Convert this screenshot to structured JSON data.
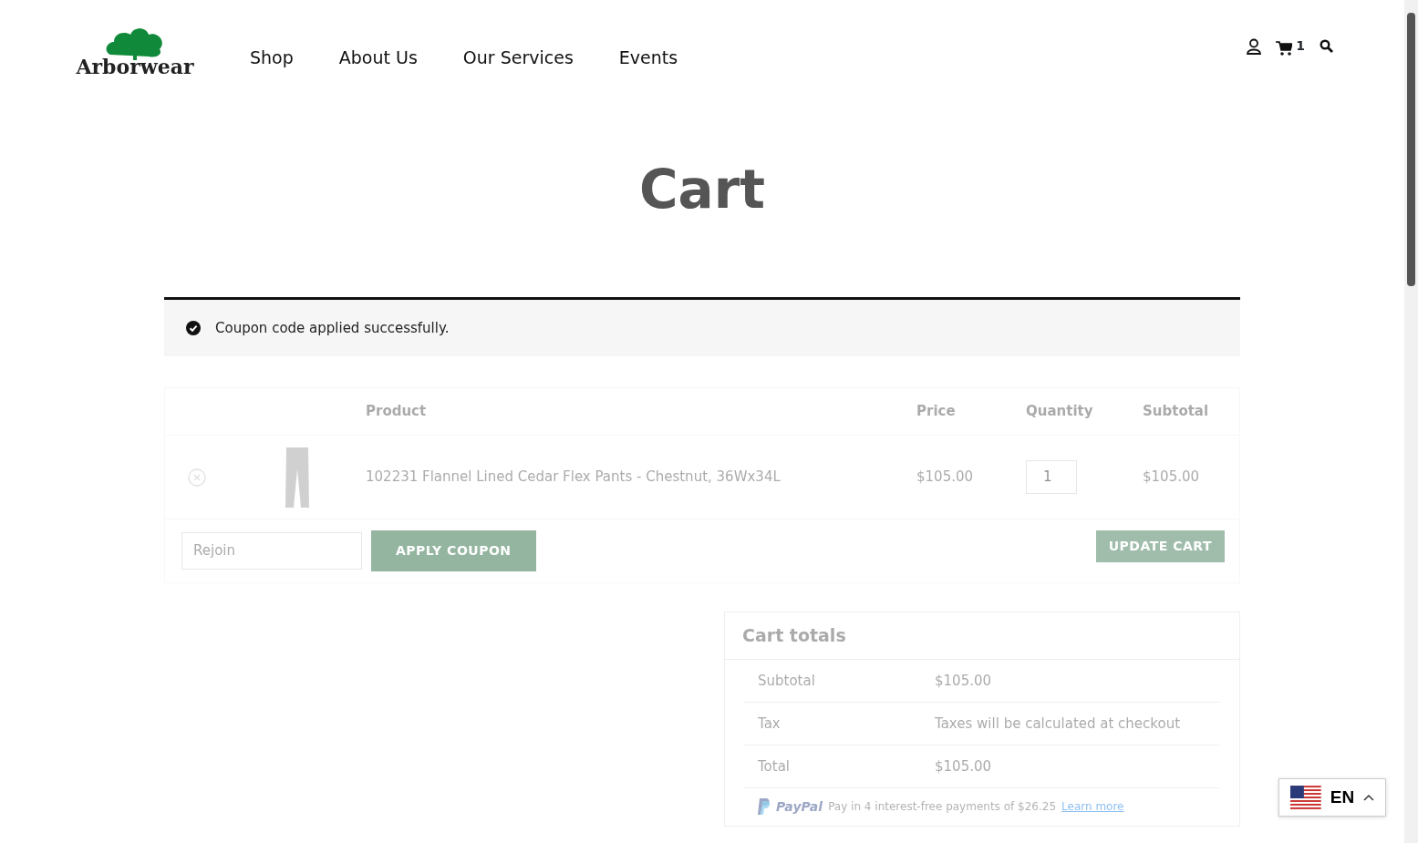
{
  "header": {
    "logo": "Arborwear",
    "nav": [
      {
        "label": "Shop"
      },
      {
        "label": "About Us"
      },
      {
        "label": "Our Services"
      },
      {
        "label": "Events"
      }
    ],
    "cart_count": "1"
  },
  "page_title": "Cart",
  "notice": {
    "message": "Coupon code applied successfully."
  },
  "cart": {
    "loading": true,
    "columns": [
      "Product",
      "Price",
      "Quantity",
      "Subtotal"
    ],
    "items": [
      {
        "name": "102231 Flannel Lined Cedar Flex Pants - Chestnut, 36Wx34L",
        "price": "$105.00",
        "quantity": "1",
        "subtotal": "$105.00"
      }
    ],
    "coupon": {
      "value": "Rejoin",
      "button": "APPLY COUPON"
    },
    "update_button": "UPDATE CART"
  },
  "totals": {
    "loading": true,
    "title": "Cart totals",
    "rows": [
      {
        "label": "Subtotal",
        "value": "$105.00"
      },
      {
        "label": "Tax",
        "value": "Taxes will be calculated at checkout"
      },
      {
        "label": "Total",
        "value": "$105.00"
      }
    ],
    "paypal": {
      "brand": "PayPal",
      "message": "Pay in 4 interest-free payments of $26.25",
      "link": "Learn more"
    }
  },
  "language": {
    "code": "EN",
    "expanded": false
  }
}
